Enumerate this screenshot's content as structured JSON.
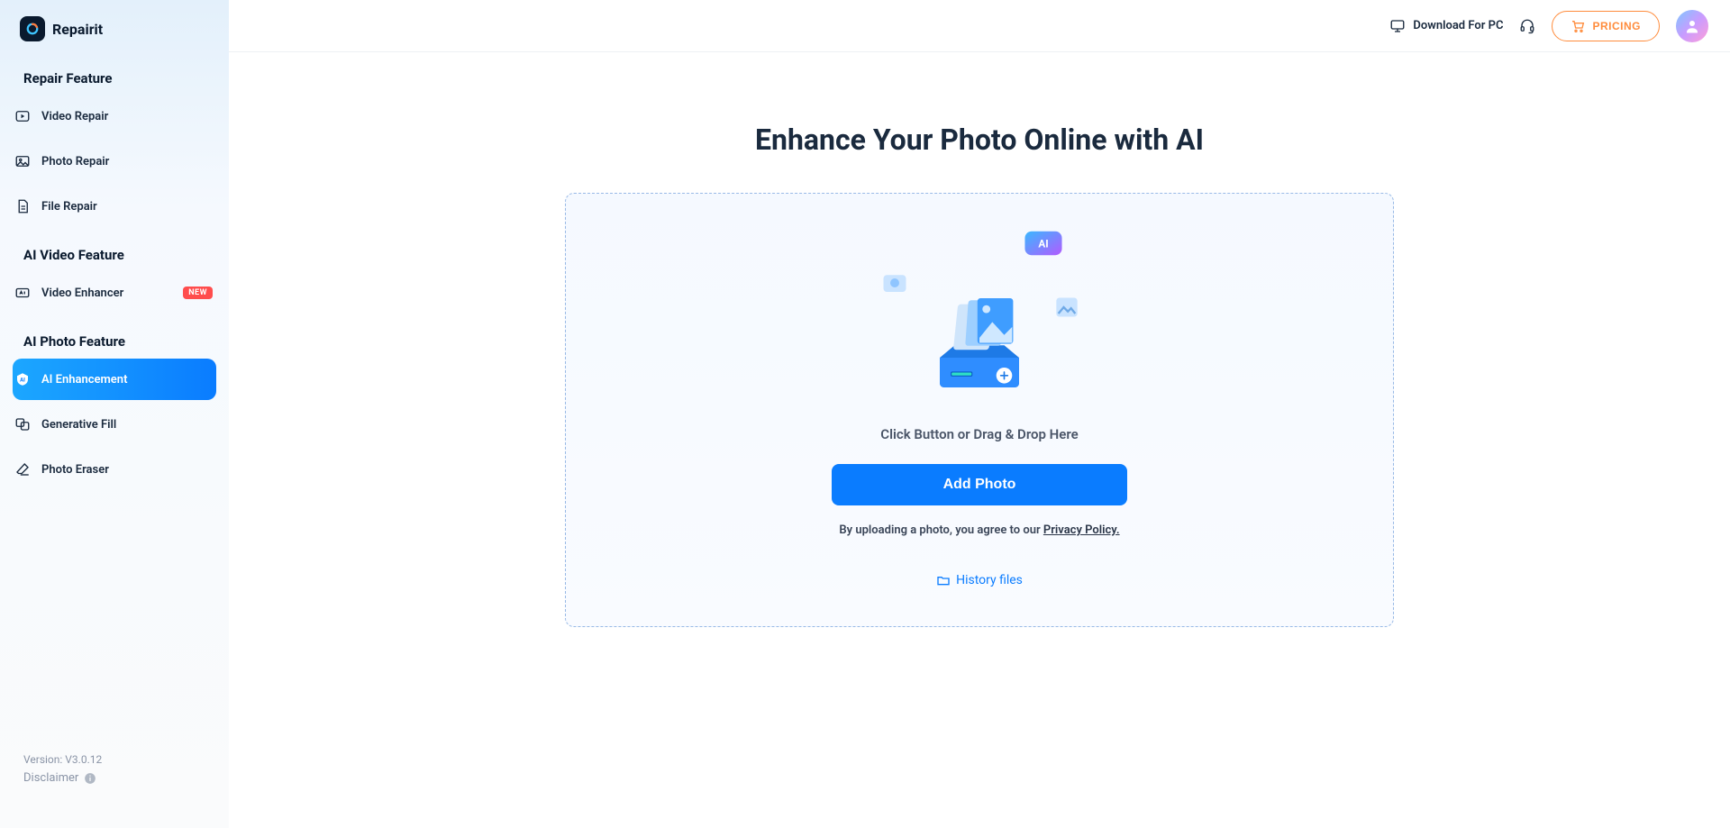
{
  "app": {
    "name": "Repairit"
  },
  "sidebar": {
    "sections": [
      {
        "title": "Repair Feature",
        "items": [
          {
            "label": "Video Repair",
            "icon": "play-box-icon"
          },
          {
            "label": "Photo Repair",
            "icon": "photo-icon"
          },
          {
            "label": "File Repair",
            "icon": "file-icon"
          }
        ]
      },
      {
        "title": "AI Video Feature",
        "items": [
          {
            "label": "Video Enhancer",
            "icon": "ai-video-icon",
            "badge": "NEW"
          }
        ]
      },
      {
        "title": "AI Photo Feature",
        "items": [
          {
            "label": "AI Enhancement",
            "icon": "ai-badge-icon",
            "active": true
          },
          {
            "label": "Generative Fill",
            "icon": "generative-icon"
          },
          {
            "label": "Photo Eraser",
            "icon": "eraser-icon"
          }
        ]
      }
    ],
    "version": "Version: V3.0.12",
    "disclaimer": "Disclaimer"
  },
  "topbar": {
    "download": "Download For PC",
    "pricing": "PRICING"
  },
  "main": {
    "title": "Enhance Your Photo Online with AI",
    "hint": "Click Button or Drag & Drop Here",
    "button": "Add Photo",
    "consent_pre": "By uploading a photo, you agree to our ",
    "consent_link": "Privacy Policy.",
    "history": "History files"
  }
}
